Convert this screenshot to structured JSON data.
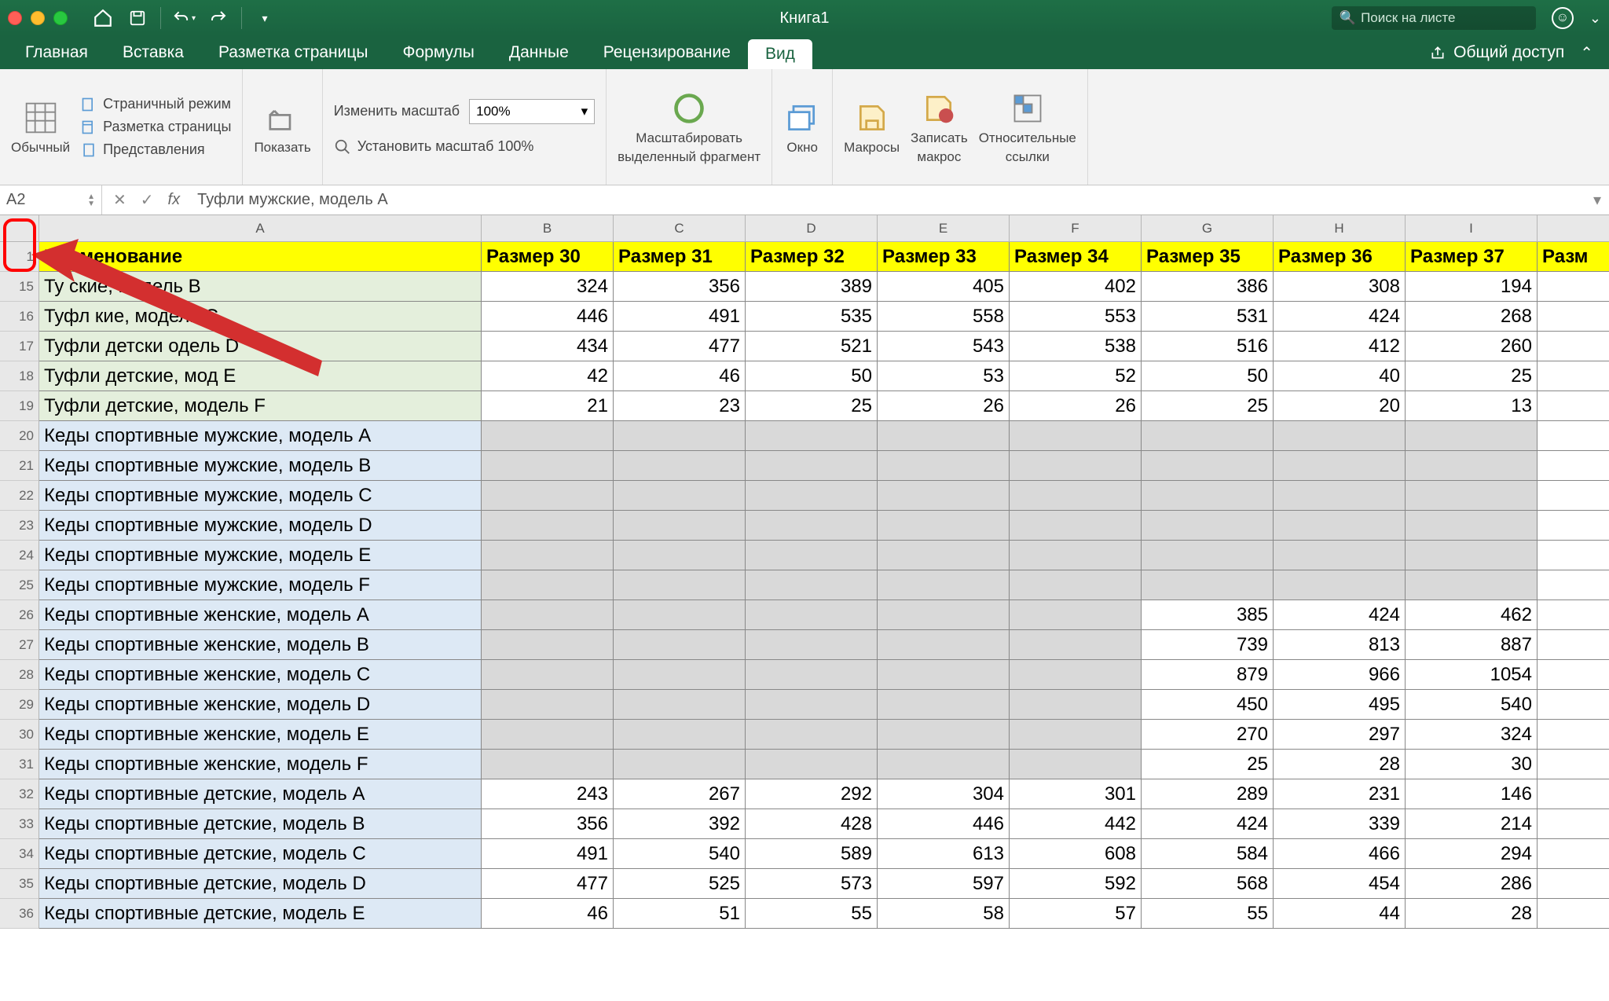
{
  "title": "Книга1",
  "search_placeholder": "Поиск на листе",
  "tabs": [
    "Главная",
    "Вставка",
    "Разметка страницы",
    "Формулы",
    "Данные",
    "Рецензирование",
    "Вид"
  ],
  "active_tab": "Вид",
  "share_label": "Общий доступ",
  "ribbon": {
    "normal": "Обычный",
    "page_mode": "Страничный режим",
    "page_layout": "Разметка страницы",
    "views": "Представления",
    "show": "Показать",
    "change_zoom": "Изменить масштаб",
    "zoom_value": "100%",
    "zoom_100": "Установить масштаб 100%",
    "zoom_to_selection1": "Масштабировать",
    "zoom_to_selection2": "выделенный фрагмент",
    "window": "Окно",
    "macros": "Макросы",
    "record_macro1": "Записать",
    "record_macro2": "макрос",
    "relative_refs1": "Относительные",
    "relative_refs2": "ссылки"
  },
  "namebox": "A2",
  "formula": "Туфли мужские, модель A",
  "columns": [
    "A",
    "B",
    "C",
    "D",
    "E",
    "F",
    "G",
    "H",
    "I"
  ],
  "header_row": [
    "Наименование",
    "Размер 30",
    "Размер 31",
    "Размер 32",
    "Размер 33",
    "Размер 34",
    "Размер 35",
    "Размер 36",
    "Размер 37",
    "Разм"
  ],
  "row_numbers": [
    1,
    15,
    16,
    17,
    18,
    19,
    20,
    21,
    22,
    23,
    24,
    25,
    26,
    27,
    28,
    29,
    30,
    31,
    32,
    33,
    34,
    35,
    36
  ],
  "rows": [
    {
      "n": 15,
      "cls": "green",
      "name": "Ту            ские, модель B",
      "v": [
        324,
        356,
        389,
        405,
        402,
        386,
        308,
        194
      ]
    },
    {
      "n": 16,
      "cls": "green",
      "name": "Туфл           кие, модель C",
      "v": [
        446,
        491,
        535,
        558,
        553,
        531,
        424,
        268
      ]
    },
    {
      "n": 17,
      "cls": "green",
      "name": "Туфли детски         одель D",
      "v": [
        434,
        477,
        521,
        543,
        538,
        516,
        412,
        260
      ]
    },
    {
      "n": 18,
      "cls": "green",
      "name": "Туфли детские, мод       E",
      "v": [
        42,
        46,
        50,
        53,
        52,
        50,
        40,
        25
      ]
    },
    {
      "n": 19,
      "cls": "green",
      "name": "Туфли детские, модель F",
      "v": [
        21,
        23,
        25,
        26,
        26,
        25,
        20,
        13
      ]
    },
    {
      "n": 20,
      "cls": "blue",
      "name": "Кеды спортивные мужские, модель A",
      "v": [
        "",
        "",
        "",
        "",
        "",
        "",
        "",
        ""
      ],
      "grey": true
    },
    {
      "n": 21,
      "cls": "blue",
      "name": "Кеды спортивные мужские, модель B",
      "v": [
        "",
        "",
        "",
        "",
        "",
        "",
        "",
        ""
      ],
      "grey": true
    },
    {
      "n": 22,
      "cls": "blue",
      "name": "Кеды спортивные мужские, модель C",
      "v": [
        "",
        "",
        "",
        "",
        "",
        "",
        "",
        ""
      ],
      "grey": true
    },
    {
      "n": 23,
      "cls": "blue",
      "name": "Кеды спортивные мужские, модель D",
      "v": [
        "",
        "",
        "",
        "",
        "",
        "",
        "",
        ""
      ],
      "grey": true
    },
    {
      "n": 24,
      "cls": "blue",
      "name": "Кеды спортивные мужские, модель E",
      "v": [
        "",
        "",
        "",
        "",
        "",
        "",
        "",
        ""
      ],
      "grey": true
    },
    {
      "n": 25,
      "cls": "blue",
      "name": "Кеды спортивные мужские, модель F",
      "v": [
        "",
        "",
        "",
        "",
        "",
        "",
        "",
        ""
      ],
      "grey": true
    },
    {
      "n": 26,
      "cls": "blue",
      "name": "Кеды спортивные женские, модель A",
      "v": [
        "",
        "",
        "",
        "",
        "",
        385,
        424,
        462
      ],
      "grey5": true
    },
    {
      "n": 27,
      "cls": "blue",
      "name": "Кеды спортивные женские, модель B",
      "v": [
        "",
        "",
        "",
        "",
        "",
        739,
        813,
        887
      ],
      "grey5": true
    },
    {
      "n": 28,
      "cls": "blue",
      "name": "Кеды спортивные женские, модель C",
      "v": [
        "",
        "",
        "",
        "",
        "",
        879,
        966,
        1054
      ],
      "grey5": true
    },
    {
      "n": 29,
      "cls": "blue",
      "name": "Кеды спортивные женские, модель D",
      "v": [
        "",
        "",
        "",
        "",
        "",
        450,
        495,
        540
      ],
      "grey5": true
    },
    {
      "n": 30,
      "cls": "blue",
      "name": "Кеды спортивные женские, модель E",
      "v": [
        "",
        "",
        "",
        "",
        "",
        270,
        297,
        324
      ],
      "grey5": true
    },
    {
      "n": 31,
      "cls": "blue",
      "name": "Кеды спортивные женские, модель F",
      "v": [
        "",
        "",
        "",
        "",
        "",
        25,
        28,
        30
      ],
      "grey5": true
    },
    {
      "n": 32,
      "cls": "blue",
      "name": "Кеды спортивные детские, модель A",
      "v": [
        243,
        267,
        292,
        304,
        301,
        289,
        231,
        146
      ]
    },
    {
      "n": 33,
      "cls": "blue",
      "name": "Кеды спортивные детские, модель B",
      "v": [
        356,
        392,
        428,
        446,
        442,
        424,
        339,
        214
      ]
    },
    {
      "n": 34,
      "cls": "blue",
      "name": "Кеды спортивные детские, модель C",
      "v": [
        491,
        540,
        589,
        613,
        608,
        584,
        466,
        294
      ]
    },
    {
      "n": 35,
      "cls": "blue",
      "name": "Кеды спортивные детские, модель D",
      "v": [
        477,
        525,
        573,
        597,
        592,
        568,
        454,
        286
      ]
    },
    {
      "n": 36,
      "cls": "blue",
      "name": "Кеды спортивные детские, модель E",
      "v": [
        46,
        51,
        55,
        58,
        57,
        55,
        44,
        28
      ]
    }
  ]
}
